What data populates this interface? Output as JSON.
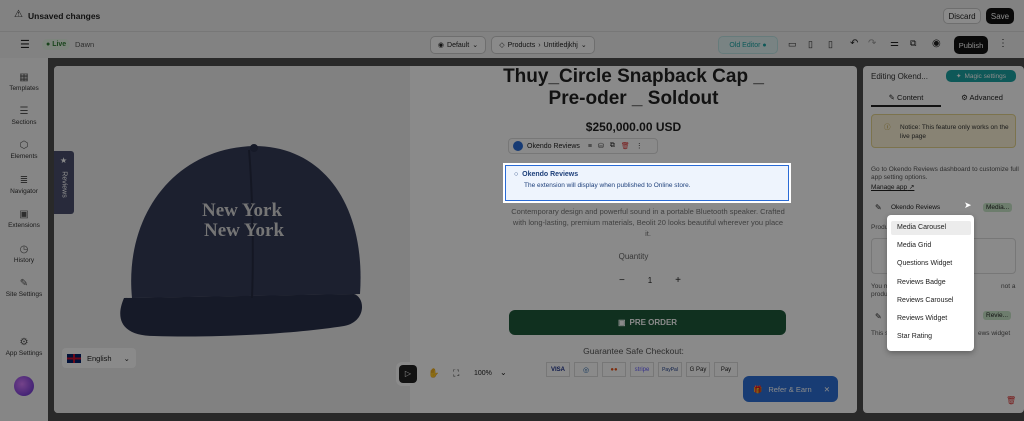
{
  "topbar": {
    "unsaved": "Unsaved changes",
    "discard": "Discard",
    "save": "Save"
  },
  "toolbar": {
    "live": "Live",
    "theme": "Dawn",
    "template": "Default",
    "page": "Products",
    "page_sub": "Untitledjkhj",
    "old_editor": "Old Editor",
    "publish": "Publish"
  },
  "sidebar": [
    {
      "label": "Templates",
      "icon": "▦"
    },
    {
      "label": "Sections",
      "icon": "☰"
    },
    {
      "label": "Elements",
      "icon": "⬡"
    },
    {
      "label": "Navigator",
      "icon": "≣"
    },
    {
      "label": "Extensions",
      "icon": "▣"
    },
    {
      "label": "History",
      "icon": "◷"
    },
    {
      "label": "Site Settings",
      "icon": "✎"
    },
    {
      "label": "App Settings",
      "icon": "⚙"
    }
  ],
  "language": "English",
  "product": {
    "title_line1": "Thuy_Circle Snapback Cap _",
    "title_line2": "Pre-oder _ Soldout",
    "price": "$250,000.00 USD",
    "okendo_label": "Okendo Reviews",
    "okendo_box_title": "Okendo Reviews",
    "okendo_box_text": "The extension will display when published to Online store.",
    "description": "Contemporary design and powerful sound in a portable Bluetooth speaker. Crafted with long-lasting, premium materials, Beolit 20 looks beautiful wherever you place it.",
    "quantity_label": "Quantity",
    "qty_minus": "−",
    "qty": "1",
    "qty_plus": "+",
    "preorder": "PRE ORDER",
    "guarantee": "Guarantee Safe Checkout:",
    "cap_text1": "New York",
    "cap_text2": "New York",
    "reviews_tab": "Reviews"
  },
  "payments": [
    "VISA",
    "◎",
    "●●",
    "stripe",
    "PayPal",
    "G Pay",
    "Pay"
  ],
  "canvas_toolbar": {
    "zoom": "100%"
  },
  "refer": "Refer & Earn",
  "right_panel": {
    "title": "Editing Okend...",
    "magic": "Magic settings",
    "tab_content": "Content",
    "tab_advanced": "Advanced",
    "notice": "Notice: This feature only works on the live page",
    "info": "Go to Okendo Reviews dashboard to customize full app setting options.",
    "manage": "Manage app",
    "row1_label": "Okendo Reviews",
    "row1_badge": "Media...",
    "row2_badge": "Revie...",
    "produ": "Produ",
    "you": "You m",
    "produ2": "produ",
    "this": "This s",
    "not_a": "not a",
    "views_widget": "ews widget"
  },
  "dropdown": [
    "Media Carousel",
    "Media Grid",
    "Questions Widget",
    "Reviews Badge",
    "Reviews Carousel",
    "Reviews Widget",
    "Star Rating"
  ],
  "colors": {
    "live": "#2e7d32",
    "accent": "#1aa3a3",
    "preorder": "#1e5a3a",
    "okendo_border": "#2a6bd6",
    "refer": "#2d6fd6"
  }
}
